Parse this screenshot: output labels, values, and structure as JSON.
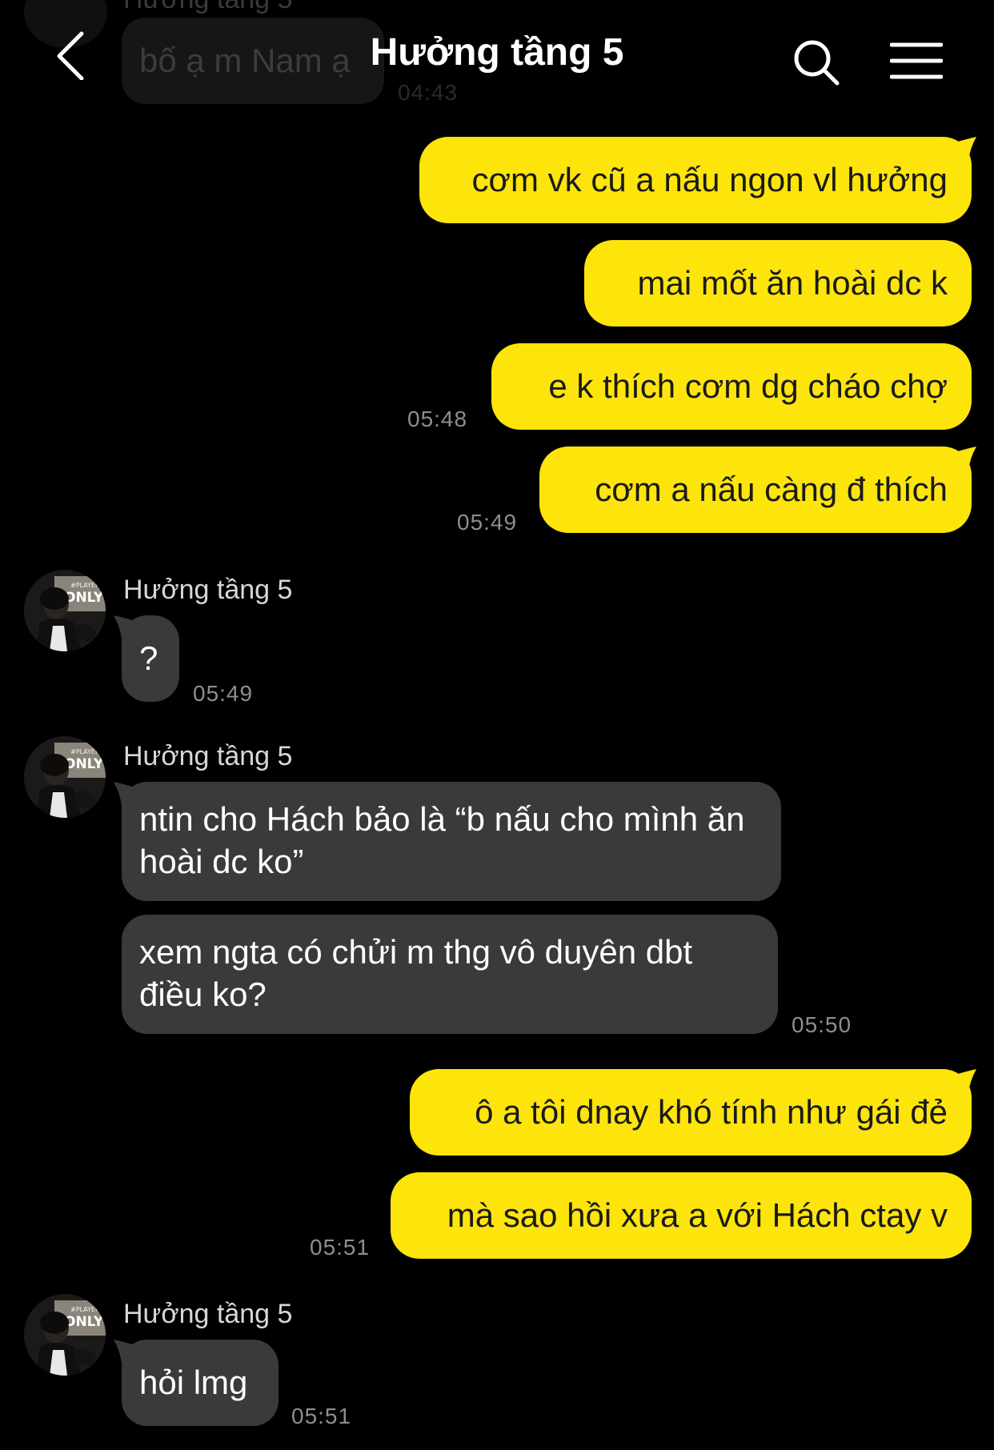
{
  "header": {
    "title": "Hưởng tầng 5",
    "back_icon": "chevron-left-icon",
    "search_icon": "search-icon",
    "menu_icon": "hamburger-menu-icon"
  },
  "colors": {
    "background": "#000000",
    "my_bubble": "#fde50b",
    "their_bubble": "#3a3a3c",
    "timestamp": "#8e8e8e"
  },
  "faded_previous": {
    "sender": "Hưởng tầng 5",
    "text": "bố ạ m Nam ạ",
    "time": "04:43"
  },
  "messages": [
    {
      "from": "me",
      "text": "cơm vk cũ a nấu ngon vl hưởng"
    },
    {
      "from": "me",
      "text": "mai mốt ăn hoài dc k"
    },
    {
      "from": "me",
      "text": "e k thích cơm dg cháo chợ",
      "time": "05:48"
    },
    {
      "from": "me",
      "text": "cơm a nấu càng đ thích",
      "time": "05:49"
    },
    {
      "from": "them",
      "sender": "Hưởng tầng 5",
      "text": "?",
      "time": "05:49"
    },
    {
      "from": "them",
      "sender": "Hưởng tầng 5",
      "text": "ntin cho Hách bảo là “b nấu cho mình ăn hoài dc ko”"
    },
    {
      "from": "them",
      "text": "xem ngta có chửi m thg vô duyên dbt điều ko?",
      "time": "05:50"
    },
    {
      "from": "me",
      "text": "ô a tôi dnay khó tính như gái đẻ"
    },
    {
      "from": "me",
      "text": "mà sao hồi xưa a với Hách ctay v",
      "time": "05:51"
    },
    {
      "from": "them",
      "sender": "Hưởng tầng 5",
      "text": "hỏi lmg",
      "time": "05:51"
    }
  ],
  "avatar": {
    "poster_text": "ONLY",
    "poster_small": "#PLAYERS"
  }
}
